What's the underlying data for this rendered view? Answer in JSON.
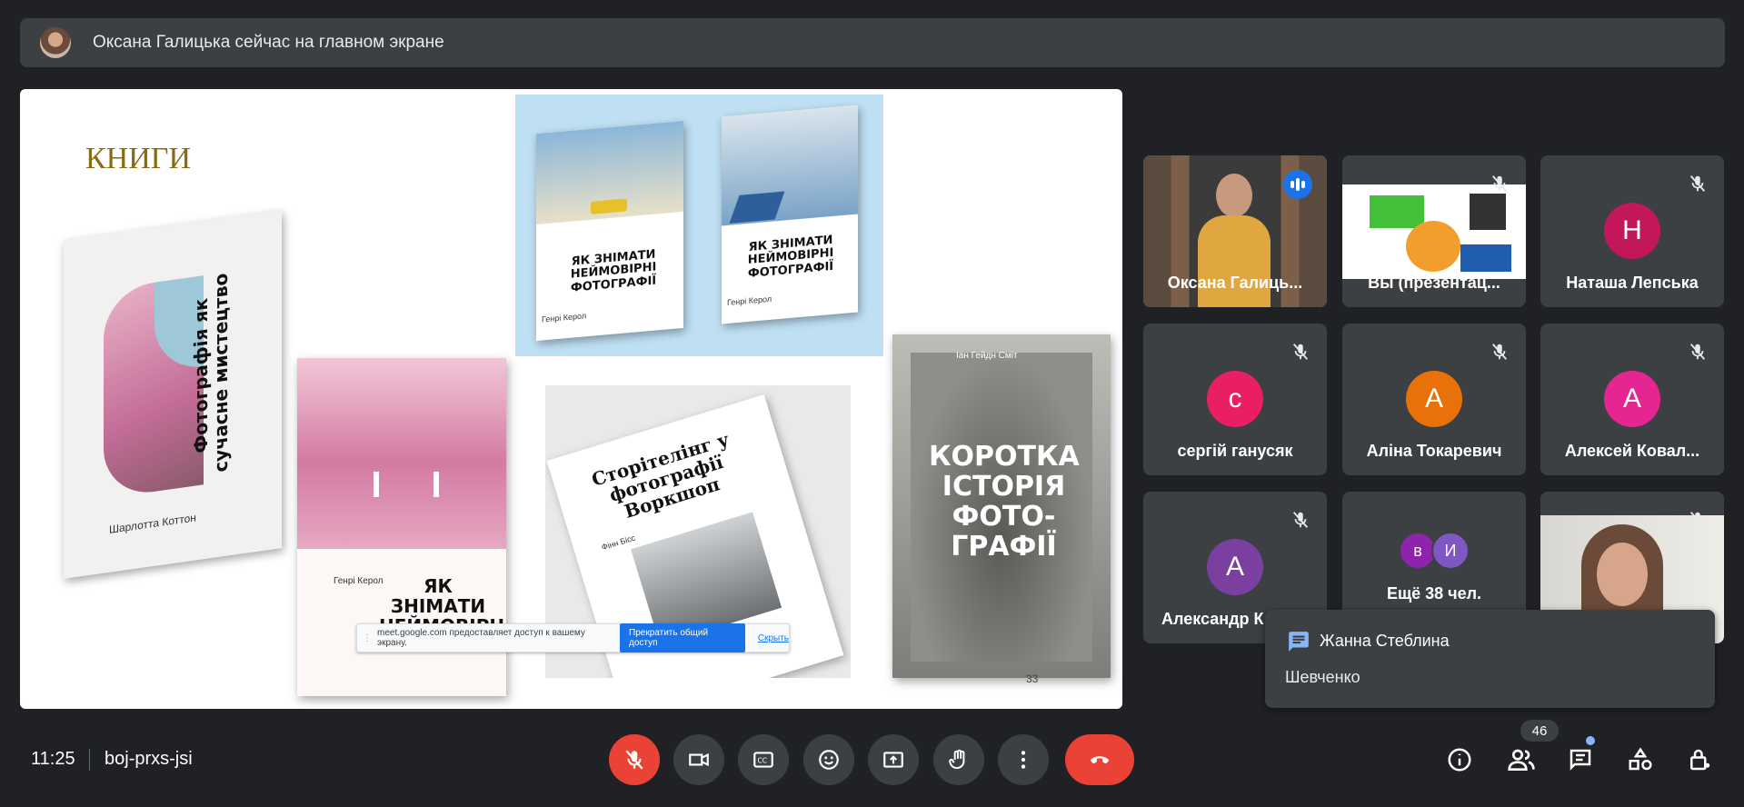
{
  "banner": {
    "text": "Оксана Галицька сейчас на главном экране"
  },
  "slide": {
    "title": "КНИГИ",
    "page_number": "33",
    "books": [
      {
        "title": "Фотографія як сучасне мистецтво",
        "author": "Шарлотта Коттон"
      },
      {
        "title": "ЯК ЗНІМАТИ НЕЙМОВІРНІ ФОТОГРАФІЇ",
        "author": "Генрі Керол"
      },
      {
        "title": "ЯК ЗНІМАТИ НЕЙМОВІРНІ ФОТОГРАФІЇ",
        "author": "Генрі Керол"
      },
      {
        "title": "ЯК ЗНІМАТИ НЕЙМОВІРНІ",
        "author": "Генрі Керол"
      },
      {
        "title": "Сторітелінг у фотографії Воркшоп",
        "author": "Фінн Бісс"
      },
      {
        "title": "КОРОТКА ІСТОРІЯ ФОТО-ГРАФІЇ",
        "author": "Іан Гейдн Сміт"
      }
    ]
  },
  "share_bar": {
    "text": "meet.google.com предоставляет доступ к вашему экрану.",
    "stop_label": "Прекратить общий доступ",
    "hide_label": "Скрыть"
  },
  "participants": [
    {
      "name": "Оксана Галиць...",
      "type": "video",
      "speaking": true
    },
    {
      "name": "Вы (презентац...",
      "type": "screen"
    },
    {
      "name": "Наташа Лепська",
      "initial": "Н",
      "color": "#c2185b"
    },
    {
      "name": "сергій ганусяк",
      "initial": "с",
      "color": "#e91e63"
    },
    {
      "name": "Аліна Токаревич",
      "initial": "А",
      "color": "#e8710a"
    },
    {
      "name": "Алексей Ковал...",
      "initial": "А",
      "color": "#e52592"
    },
    {
      "name": "Александр К",
      "initial": "А",
      "color": "#7b3fa0"
    },
    {
      "name": "Ещё 38 чел.",
      "initials": [
        "в",
        "И"
      ],
      "colors": [
        "#8e24aa",
        "#7e57c2"
      ]
    },
    {
      "name": "",
      "type": "video"
    }
  ],
  "toast": {
    "title": "Жанна Стеблина",
    "body": "Шевченко"
  },
  "bottom_bar": {
    "time": "11:25",
    "meeting_code": "boj-prxs-jsi",
    "participant_count": "46"
  }
}
